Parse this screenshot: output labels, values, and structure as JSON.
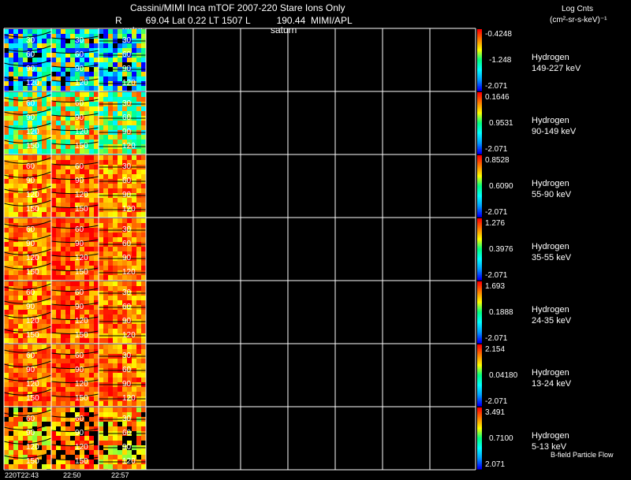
{
  "header": {
    "line1": "Cassini/MIMI Inca mTOF  2007-220   Stare   Ions Only",
    "line2": "R         69.04 Lat 0.22 LT 1507 L          190.44  MIMI/APL",
    "saturn_label_1": "satur",
    "saturn_label_2": "saturn",
    "units_line1": "Log Cnts",
    "units_line2": "(cm²-sr-s-keV)⁻¹"
  },
  "footer": {
    "time_labels": [
      "220T22:43",
      "22:50",
      "22:57"
    ],
    "flow_label": "B-field Particle Flow"
  },
  "colors": {
    "background": "#000000",
    "grid": "#ffffff",
    "colormap": [
      "#0000ff",
      "#00a0ff",
      "#00ffff",
      "#00ff80",
      "#ffff00",
      "#ff8000",
      "#ff0000"
    ]
  },
  "chart_data": {
    "type": "heatmap",
    "rows": [
      {
        "species": "Hydrogen",
        "energy": "149-227 keV",
        "cb_max": "-0.4248",
        "cb_mid": "-1.248",
        "cb_min": "-2.071",
        "intensity": 0.35,
        "noise": 0.45,
        "sparse": false,
        "contours": [
          "30",
          "60",
          "90",
          "120"
        ],
        "contours_right": [
          "30",
          "60",
          "90",
          "120"
        ]
      },
      {
        "species": "Hydrogen",
        "energy": "90-149 keV",
        "cb_max": "0.1646",
        "cb_mid": "0.9531",
        "cb_min": "-2.071",
        "intensity": 0.6,
        "noise": 0.3,
        "sparse": false,
        "contours": [
          "60",
          "90",
          "120",
          "150"
        ],
        "contours_right": [
          "30",
          "60",
          "90",
          "120"
        ]
      },
      {
        "species": "Hydrogen",
        "energy": "55-90 keV",
        "cb_max": "0.8528",
        "cb_mid": "0.6090",
        "cb_min": "-2.071",
        "intensity": 0.82,
        "noise": 0.18,
        "sparse": false,
        "contours": [
          "60",
          "90",
          "120",
          "150"
        ],
        "contours_right": [
          "30",
          "60",
          "90",
          "120"
        ]
      },
      {
        "species": "Hydrogen",
        "energy": "35-55 keV",
        "cb_max": "1.276",
        "cb_mid": "0.3976",
        "cb_min": "-2.071",
        "intensity": 0.85,
        "noise": 0.16,
        "sparse": false,
        "contours": [
          "60",
          "90",
          "120",
          "150"
        ],
        "contours_right": [
          "30",
          "60",
          "90",
          "120"
        ]
      },
      {
        "species": "Hydrogen",
        "energy": "24-35 keV",
        "cb_max": "1.693",
        "cb_mid": "0.1888",
        "cb_min": "-2.071",
        "intensity": 0.84,
        "noise": 0.18,
        "sparse": false,
        "contours": [
          "60",
          "90",
          "120",
          "150"
        ],
        "contours_right": [
          "30",
          "60",
          "90",
          "120"
        ]
      },
      {
        "species": "Hydrogen",
        "energy": "13-24 keV",
        "cb_max": "2.154",
        "cb_mid": "0.04180",
        "cb_min": "-2.071",
        "intensity": 0.85,
        "noise": 0.17,
        "sparse": false,
        "contours": [
          "60",
          "90",
          "120",
          "150"
        ],
        "contours_right": [
          "30",
          "60",
          "90",
          "120"
        ]
      },
      {
        "species": "Hydrogen",
        "energy": "5-13 keV",
        "cb_max": "3.491",
        "cb_mid": "0.7100",
        "cb_min": "2.071",
        "intensity": 0.78,
        "noise": 0.2,
        "sparse": true,
        "contours": [
          "60",
          "90",
          "120",
          "150"
        ],
        "contours_right": [
          "30",
          "60",
          "90",
          "120"
        ]
      }
    ],
    "columns": [
      "220T22:43",
      "22:50",
      "22:57"
    ]
  }
}
